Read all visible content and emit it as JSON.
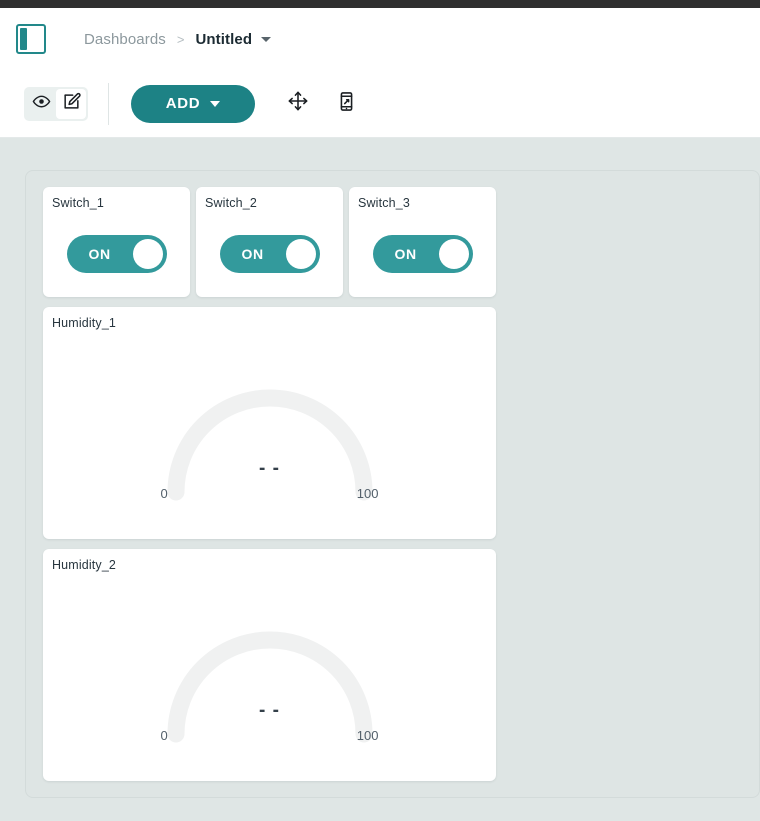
{
  "header": {
    "sidebar_toggle_name": "panel-left-icon",
    "breadcrumb": {
      "root": "Dashboards",
      "separator": ">",
      "current": "Untitled"
    }
  },
  "toolbar": {
    "view_mode": {
      "preview_icon": "eye-icon",
      "edit_icon": "pencil-square-icon",
      "active": "edit"
    },
    "add_label": "ADD",
    "move_icon": "arrows-move-icon",
    "mobile_icon": "mobile-layout-icon"
  },
  "colors": {
    "brand_teal": "#1d8285",
    "switch_teal": "#339a9c",
    "canvas_bg": "#dfe6e5",
    "gauge_track": "#f0f1f1",
    "topbar": "#2f2f2f"
  },
  "widgets": {
    "switches": [
      {
        "title": "Switch_1",
        "state": "ON",
        "checked": true
      },
      {
        "title": "Switch_2",
        "state": "ON",
        "checked": true
      },
      {
        "title": "Switch_3",
        "state": "ON",
        "checked": true
      }
    ],
    "gauges": [
      {
        "title": "Humidity_1",
        "value": "- -",
        "min": "0",
        "max": "100"
      },
      {
        "title": "Humidity_2",
        "value": "- -",
        "min": "0",
        "max": "100"
      }
    ]
  },
  "chart_data": [
    {
      "type": "gauge",
      "title": "Humidity_1",
      "value": null,
      "value_display": "- -",
      "min": 0,
      "max": 100,
      "tick_labels": [
        "0",
        "100"
      ],
      "arc_span_degrees": 180,
      "filled_fraction": 0,
      "track_color": "#f0f1f1",
      "grid": false,
      "legend": "none"
    },
    {
      "type": "gauge",
      "title": "Humidity_2",
      "value": null,
      "value_display": "- -",
      "min": 0,
      "max": 100,
      "tick_labels": [
        "0",
        "100"
      ],
      "arc_span_degrees": 180,
      "filled_fraction": 0,
      "track_color": "#f0f1f1",
      "grid": false,
      "legend": "none"
    }
  ]
}
